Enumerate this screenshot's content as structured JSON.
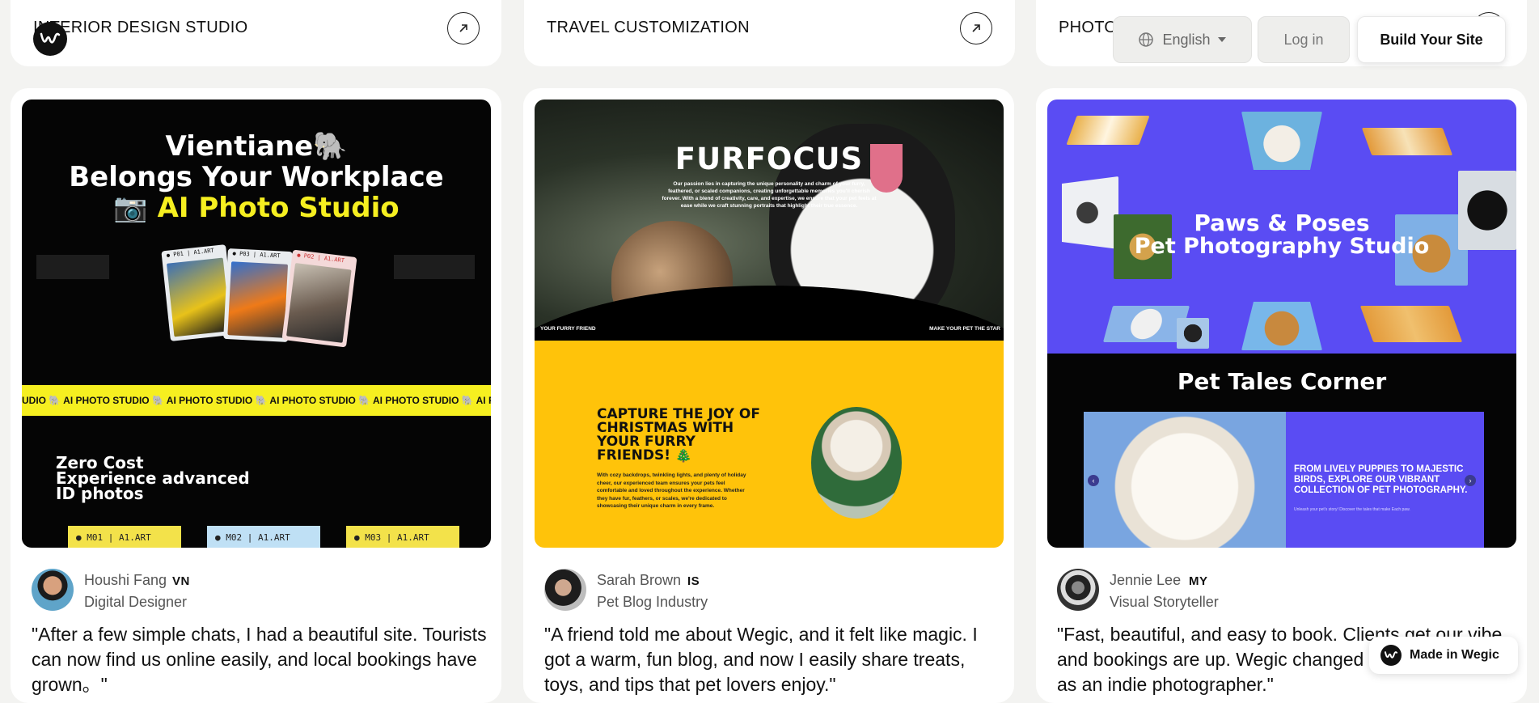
{
  "header": {
    "language_label": "English",
    "login_label": "Log in",
    "build_label": "Build Your Site"
  },
  "categories": [
    {
      "title": "INTERIOR DESIGN STUDIO"
    },
    {
      "title": "TRAVEL CUSTOMIZATION"
    },
    {
      "title": "PHOTO"
    }
  ],
  "testimonials": [
    {
      "name": "Houshi Fang",
      "country": "VN",
      "role": "Digital Designer",
      "quote": "\"After a few simple chats, I had a beautiful site. Tourists can now find us online easily, and local bookings have grown。\"",
      "preview": {
        "headline1": "Vientiane🐘",
        "headline2": "Belongs Your Workplace",
        "headline3_prefix": "📷",
        "headline3": "AI Photo Studio",
        "band_text": "UDIO 🐘 AI PHOTO STUDIO 🐘 AI PHOTO STUDIO 🐘 AI PHOTO STUDIO 🐘 AI PHOTO STUDIO 🐘 AI PHOTO STUDIO 🐘 AI PHOTO S",
        "zero1": "Zero Cost",
        "zero2": "Experience advanced",
        "zero3": "ID photos",
        "tags": [
          "● M01 | A1.ART",
          "● M02 | A1.ART",
          "● M03 | A1.ART"
        ],
        "polaroid_tags": [
          "● P01 | A1.ART",
          "● P03 | A1.ART",
          "● P02 | A1.ART"
        ]
      }
    },
    {
      "name": "Sarah Brown",
      "country": "IS",
      "role": "Pet Blog Industry",
      "quote": "\"A friend told me about Wegic, and it felt like magic. I got a warm, fun blog, and now I easily share treats, toys, and tips that pet lovers enjoy.\"",
      "preview": {
        "title": "FURFOCUS",
        "intro": "Our passion lies in capturing the unique personality and charm of your furry, feathered, or scaled companions, creating unforgettable memories you'll cherish forever. With a blend of creativity, care, and expertise, we ensure that your pet feels at ease while we craft stunning portraits that highlight their true essence.",
        "left_caption": "YOUR FURRY FRIEND",
        "right_caption": "MAKE YOUR PET THE STAR",
        "headline": "CAPTURE THE JOY OF CHRISTMAS WITH YOUR FURRY FRIENDS! 🎄",
        "body": "With cozy backdrops, twinkling lights, and plenty of holiday cheer, our experienced team ensures your pets feel comfortable and loved throughout the experience. Whether they have fur, feathers, or scales, we're dedicated to showcasing their unique charm in every frame."
      }
    },
    {
      "name": "Jennie Lee",
      "country": "MY",
      "role": "Visual Storyteller",
      "quote": "\"Fast, beautiful, and easy to book. Clients get our vibe, and bookings are up. Wegic changed everything for me as an indie photographer.\"",
      "preview": {
        "title1": "Paws & Poses",
        "title2": "Pet Photography Studio",
        "section_title": "Pet Tales Corner",
        "slide_text": "FROM LIVELY PUPPIES TO MAJESTIC BIRDS, EXPLORE OUR VIBRANT COLLECTION OF PET PHOTOGRAPHY.",
        "slide_small": "Unleash your pet's story! Discover the tales that make Each paw."
      }
    }
  ],
  "badge": {
    "label": "Made in Wegic"
  },
  "colors": {
    "accent_yellow": "#f6ef20",
    "purple": "#5a4cf3",
    "gold": "#ffc30a"
  },
  "icons": [
    "arrow-up-right-icon",
    "globe-icon",
    "caret-down-icon",
    "wegic-logo-icon"
  ]
}
